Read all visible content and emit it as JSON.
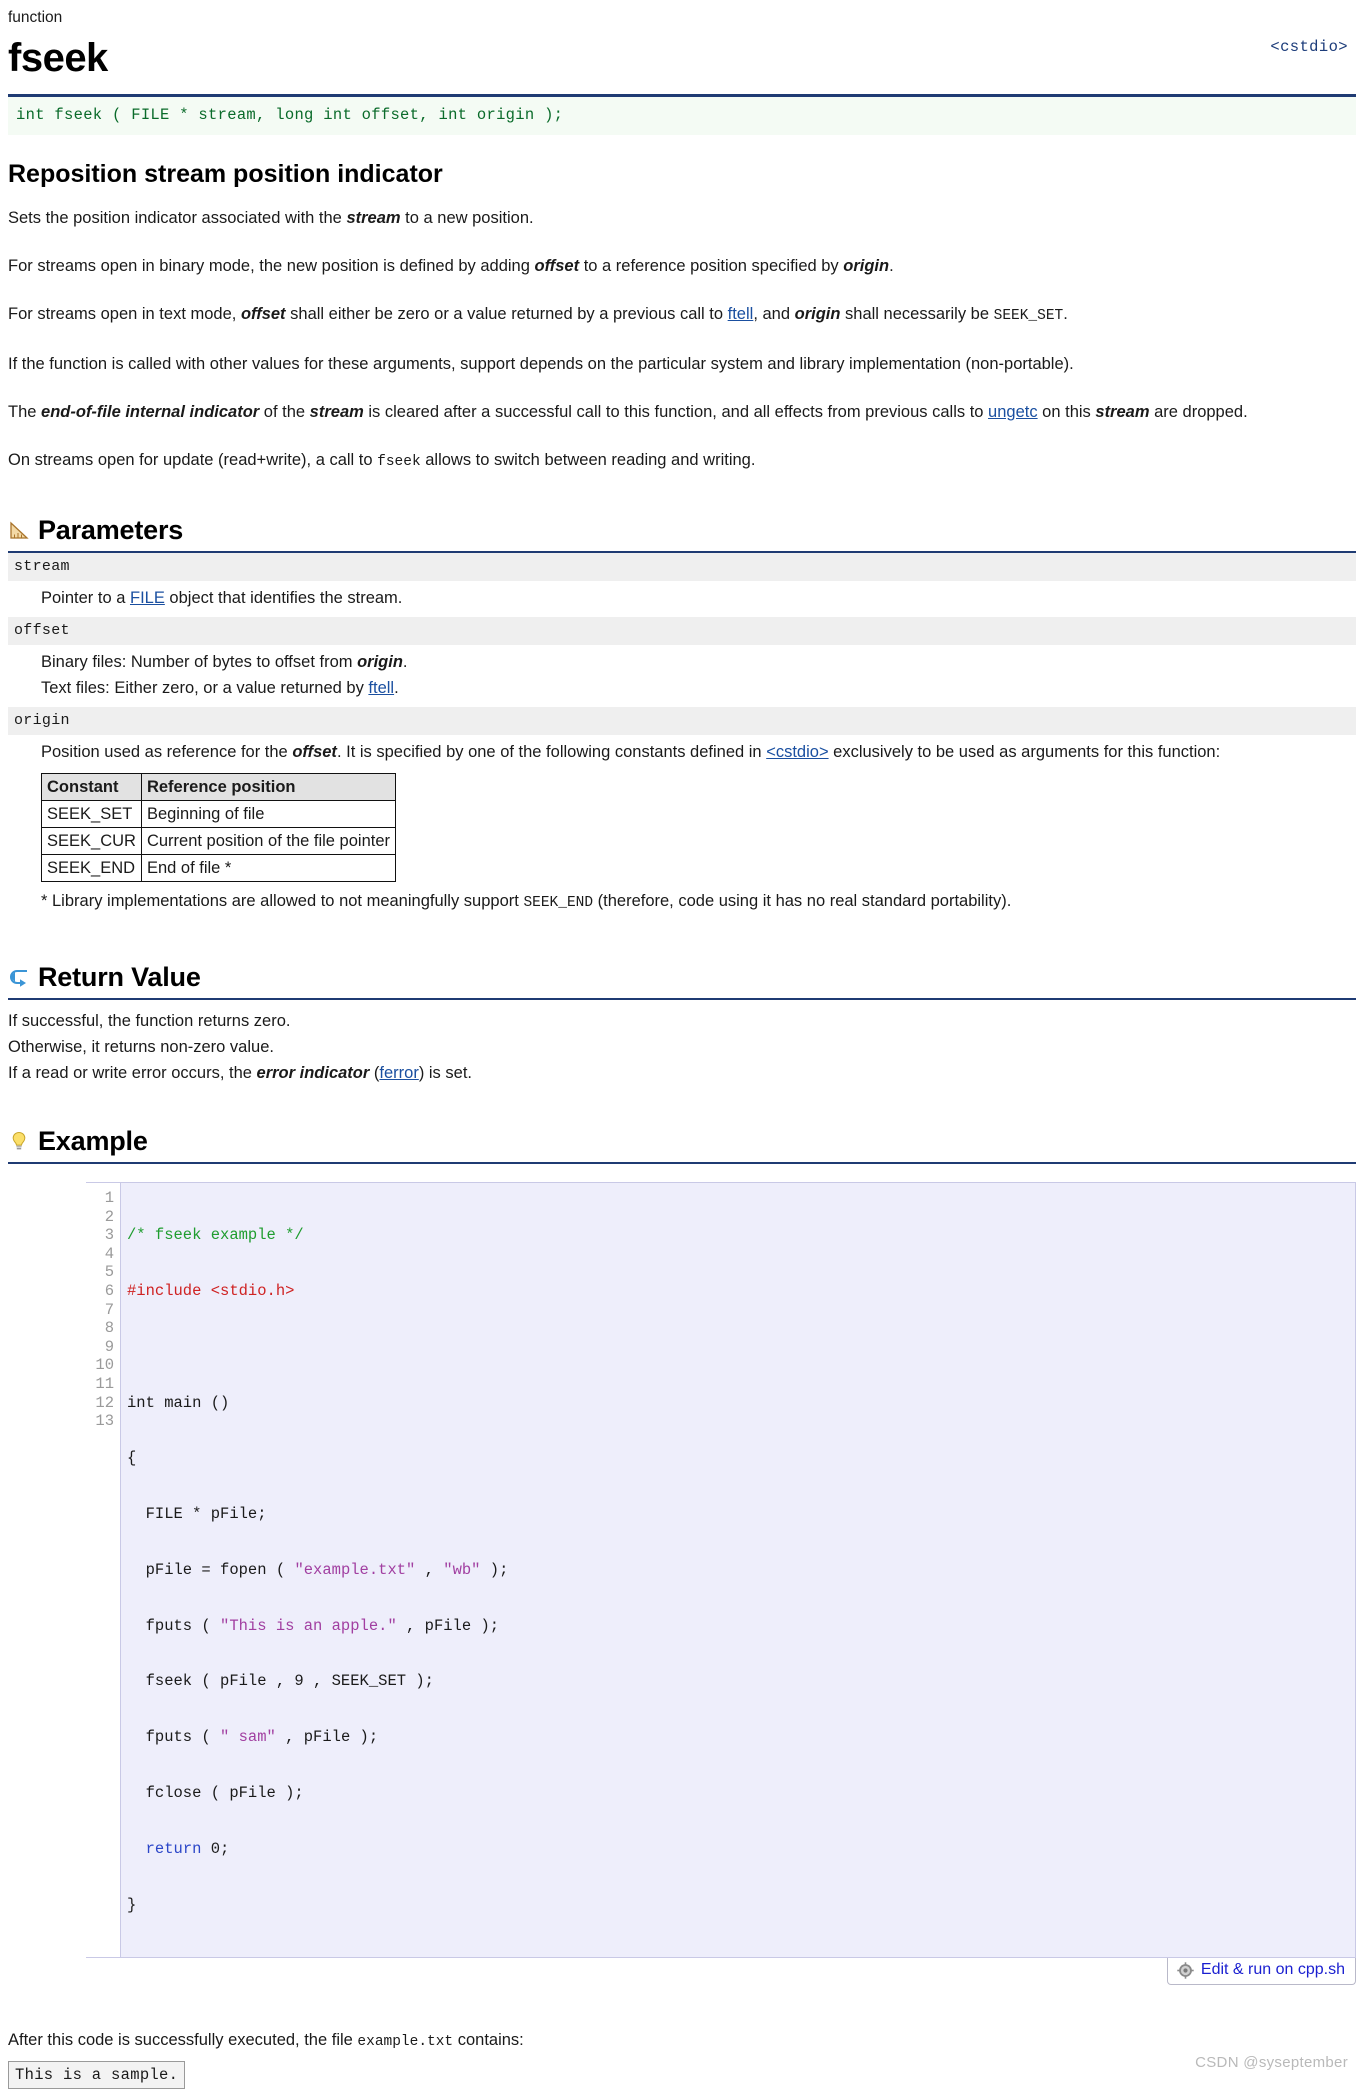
{
  "header": {
    "kind": "function",
    "title": "fseek",
    "include": "<cstdio>"
  },
  "prototype": "int fseek ( FILE * stream, long int offset, int origin );",
  "summary": {
    "heading": "Reposition stream position indicator",
    "paragraphs": [
      "Sets the position indicator associated with the stream to a new position.",
      "For streams open in binary mode, the new position is defined by adding offset to a reference position specified by origin.",
      "For streams open in text mode, offset shall either be zero or a value returned by a previous call to ftell, and origin shall necessarily be SEEK_SET.",
      "If the function is called with other values for these arguments, support depends on the particular system and library implementation (non-portable).",
      "The end-of-file internal indicator of the stream is cleared after a successful call to this function, and all effects from previous calls to ungetc on this stream are dropped.",
      "On streams open for update (read+write), a call to fseek allows to switch between reading and writing."
    ],
    "p1": {
      "a": "Sets the position indicator associated with the ",
      "b": "stream",
      "c": " to a new position."
    },
    "p2": {
      "a": "For streams open in binary mode, the new position is defined by adding ",
      "b": "offset",
      "c": " to a reference position specified by ",
      "d": "origin",
      "e": "."
    },
    "p3": {
      "a": "For streams open in text mode, ",
      "b": "offset",
      "c": " shall either be zero or a value returned by a previous call to ",
      "link": "ftell",
      "d": ", and ",
      "e": "origin",
      "f": " shall necessarily be ",
      "const": "SEEK_SET",
      "g": "."
    },
    "p4": "If the function is called with other values for these arguments, support depends on the particular system and library implementation (non-portable).",
    "p5": {
      "a": "The ",
      "b": "end-of-file internal indicator",
      "c": " of the ",
      "d": "stream",
      "e": " is cleared after a successful call to this function, and all effects from previous calls to ",
      "link": "ungetc",
      "f": " on this ",
      "g": "stream",
      "h": " are dropped."
    },
    "p6": {
      "a": "On streams open for update (read+write), a call to ",
      "code": "fseek",
      "b": " allows to switch between reading and writing."
    }
  },
  "parameters": {
    "heading": "Parameters",
    "icon": "ruler-icon",
    "items": [
      {
        "name": "stream",
        "desc_a": "Pointer to a ",
        "desc_link": "FILE",
        "desc_b": " object that identifies the stream."
      },
      {
        "name": "offset",
        "line1_a": "Binary files: Number of bytes to offset from ",
        "line1_b": "origin",
        "line1_c": ".",
        "line2_a": "Text files: Either zero, or a value returned by ",
        "line2_link": "ftell",
        "line2_b": "."
      },
      {
        "name": "origin",
        "desc_a": "Position used as reference for the ",
        "desc_b": "offset",
        "desc_c": ". It is specified by one of the following constants defined in ",
        "desc_link": "<cstdio>",
        "desc_d": " exclusively to be used as arguments for this function:"
      }
    ],
    "constants_table": {
      "headers": [
        "Constant",
        "Reference position"
      ],
      "rows": [
        [
          "SEEK_SET",
          "Beginning of file"
        ],
        [
          "SEEK_CUR",
          "Current position of the file pointer"
        ],
        [
          "SEEK_END",
          "End of file *"
        ]
      ]
    },
    "footnote_a": "* Library implementations are allowed to not meaningfully support ",
    "footnote_code": "SEEK_END",
    "footnote_b": " (therefore, code using it has no real standard portability)."
  },
  "return_value": {
    "heading": "Return Value",
    "icon": "return-arrow-icon",
    "lines": [
      "If successful, the function returns zero.",
      "Otherwise, it returns non-zero value."
    ],
    "line3_a": "If a read or write error occurs, the ",
    "line3_b": "error indicator",
    "line3_c": " (",
    "line3_link": "ferror",
    "line3_d": ") is set."
  },
  "example": {
    "heading": "Example",
    "icon": "lightbulb-icon",
    "line_numbers": [
      "1",
      "2",
      "3",
      "4",
      "5",
      "6",
      "7",
      "8",
      "9",
      "10",
      "11",
      "12",
      "13"
    ],
    "code_lines": [
      "/* fseek example */",
      "#include <stdio.h>",
      "",
      "int main ()",
      "{",
      "  FILE * pFile;",
      "  pFile = fopen ( \"example.txt\" , \"wb\" );",
      "  fputs ( \"This is an apple.\" , pFile );",
      "  fseek ( pFile , 9 , SEEK_SET );",
      "  fputs ( \" sam\" , pFile );",
      "  fclose ( pFile );",
      "  return 0;",
      "}"
    ],
    "run_button": {
      "label": "Edit & run on cpp.sh",
      "icon": "gear-icon"
    },
    "after_a": "After this code is successfully executed, the file ",
    "after_file": "example.txt",
    "after_b": " contains:",
    "output": "This is a sample."
  },
  "watermark": "CSDN @syseptember",
  "colors": {
    "rule": "#1f3b73",
    "prototype_bg": "#f4fbf4",
    "prototype_text": "#0a6b2a",
    "link": "#1a4fa0",
    "code_bg": "#eeeefb",
    "comment": "#1f9d2f",
    "preproc": "#cf2222",
    "string": "#a13fa1",
    "keyword": "#2b46c8",
    "button_text": "#1a1fd0"
  }
}
